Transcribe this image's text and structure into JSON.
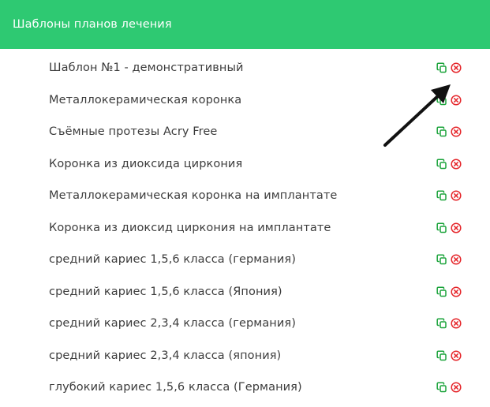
{
  "header": {
    "title": "Шаблоны планов лечения"
  },
  "colors": {
    "accent": "#2ec972",
    "copy_icon": "#1aa33a",
    "delete_icon": "#e5252a",
    "arrow": "#111111"
  },
  "templates": [
    {
      "label": "Шаблон №1 - демонстративный",
      "copy_icon": "copy-icon",
      "delete_icon": "delete-circle-x-icon"
    },
    {
      "label": "Металлокерамическая коронка",
      "copy_icon": "copy-icon",
      "delete_icon": "delete-circle-x-icon"
    },
    {
      "label": "Съёмные протезы Acry Free",
      "copy_icon": "copy-icon",
      "delete_icon": "delete-circle-x-icon"
    },
    {
      "label": "Коронка из диоксида циркония",
      "copy_icon": "copy-icon",
      "delete_icon": "delete-circle-x-icon"
    },
    {
      "label": "Металлокерамическая коронка на имплантате",
      "copy_icon": "copy-icon",
      "delete_icon": "delete-circle-x-icon"
    },
    {
      "label": "Коронка из диоксид циркония на имплантате",
      "copy_icon": "copy-icon",
      "delete_icon": "delete-circle-x-icon"
    },
    {
      "label": "средний кариес 1,5,6 класса (германия)",
      "copy_icon": "copy-icon",
      "delete_icon": "delete-circle-x-icon"
    },
    {
      "label": "средний кариес 1,5,6 класса (Япония)",
      "copy_icon": "copy-icon",
      "delete_icon": "delete-circle-x-icon"
    },
    {
      "label": "средний кариес 2,3,4 класса (германия)",
      "copy_icon": "copy-icon",
      "delete_icon": "delete-circle-x-icon"
    },
    {
      "label": "средний кариес 2,3,4 класса (япония)",
      "copy_icon": "copy-icon",
      "delete_icon": "delete-circle-x-icon"
    },
    {
      "label": "глубокий кариес 1,5,6 класса (Германия)",
      "copy_icon": "copy-icon",
      "delete_icon": "delete-circle-x-icon"
    }
  ],
  "annotation": {
    "icon": "arrow-pointer-icon"
  }
}
